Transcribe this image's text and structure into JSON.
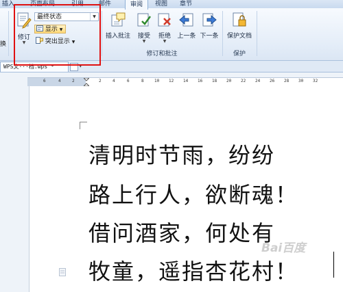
{
  "tabs": [
    {
      "label": "插入",
      "active": false
    },
    {
      "label": "页面布局",
      "active": false
    },
    {
      "label": "引用",
      "active": false
    },
    {
      "label": "邮件",
      "active": false
    },
    {
      "label": "审阅",
      "active": true
    },
    {
      "label": "视图",
      "active": false
    },
    {
      "label": "章节",
      "active": false
    }
  ],
  "ribbon": {
    "left_partial": "换",
    "revision": {
      "track_label": "修订",
      "markup_select": "最终状态",
      "show_label": "显示",
      "balloon_label": "突出显示"
    },
    "comments": {
      "insert_comment": "插入批注",
      "accept": "接受",
      "reject": "拒绝",
      "previous": "上一条",
      "next": "下一条",
      "group_label": "修订和批注"
    },
    "protect": {
      "protect_document": "保护文档",
      "group_label": "保护"
    }
  },
  "doc_tabs": [
    {
      "label": "WPS文···档.wps *",
      "active": true
    }
  ],
  "ruler": {
    "ticks": [
      "6",
      "4",
      "2",
      "2",
      "4",
      "6",
      "8",
      "10",
      "12",
      "14",
      "16",
      "18",
      "20",
      "22",
      "24",
      "26",
      "28",
      "30",
      "32"
    ]
  },
  "document": {
    "lines": [
      "清明时节雨，纷纷",
      "路上行人，欲断魂！",
      "借问酒家，何处有",
      "牧童，遥指杏花村！"
    ]
  },
  "watermark": "Bai百度",
  "colors": {
    "highlight_box": "#e01010",
    "ribbon_bg": "#e4edf8",
    "active_button": "#ffd978"
  }
}
